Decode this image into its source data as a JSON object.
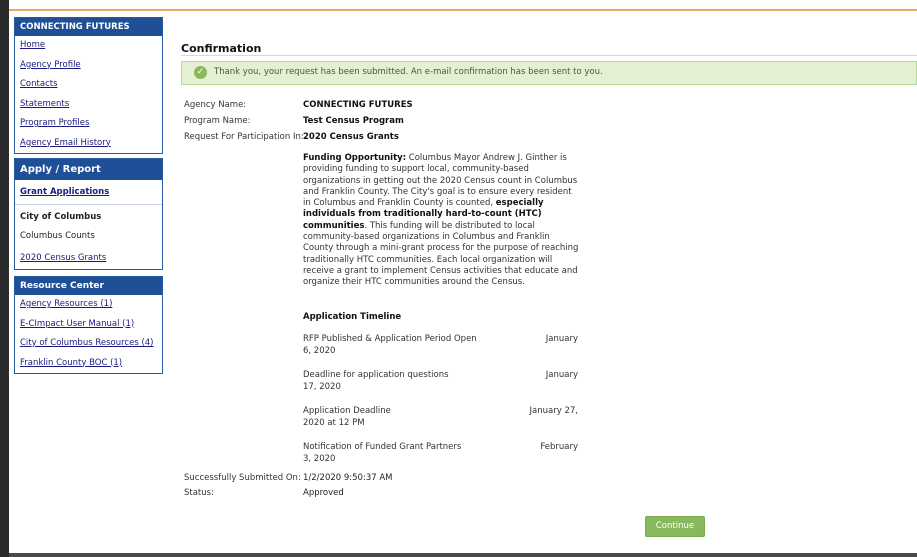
{
  "sidebar": {
    "panel1": {
      "header": "CONNECTING FUTURES",
      "items": [
        "Home",
        "Agency Profile",
        "Contacts",
        "Statements",
        "Program Profiles",
        "Agency Email History"
      ]
    },
    "panel2": {
      "header": "Apply / Report",
      "grant_applications": "Grant Applications",
      "city_label": "City of Columbus",
      "columbus_counts": "Columbus Counts",
      "census_grants": "2020 Census Grants"
    },
    "panel3": {
      "header": "Resource Center",
      "items": [
        "Agency Resources (1)",
        "E-CImpact User Manual (1)",
        "City of Columbus Resources (4)",
        "Franklin County BOC (1)"
      ]
    }
  },
  "main": {
    "title": "Confirmation",
    "alert": "Thank you, your request has been submitted. An e-mail confirmation has been sent to you.",
    "agency_label": "Agency Name:",
    "agency_value": "CONNECTING FUTURES",
    "program_label": "Program Name:",
    "program_value": "Test Census Program",
    "request_label": "Request For Participation In:",
    "request_value": "2020 Census Grants",
    "description": {
      "lead": "Funding Opportunity:",
      "p1": " Columbus Mayor Andrew J. Ginther is providing funding to support local, community-based organizations in getting out the 2020 Census count in Columbus and Franklin County. The City's goal is to ensure every resident in Columbus and Franklin County is counted, ",
      "emph": "especially individuals from traditionally hard-to-count (HTC) communities",
      "p2": ". This funding will be distributed to local community-based organizations in Columbus and Franklin County through a mini-grant process for the purpose of reaching traditionally HTC communities.  Each local organization will receive a grant to implement Census activities that educate and organize their HTC communities around the Census."
    },
    "timeline_title": "Application Timeline",
    "timeline": [
      {
        "event": "RFP Published & Application Period Open",
        "date": "January",
        "cont": "6, 2020"
      },
      {
        "event": "Deadline for application questions",
        "date": "January",
        "cont": "17, 2020"
      },
      {
        "event": "Application Deadline",
        "date": "January 27,",
        "cont": "2020 at 12 PM"
      },
      {
        "event": "Notification of Funded Grant Partners",
        "date": "February",
        "cont": "3, 2020"
      }
    ],
    "submitted_label": "Successfully Submitted On:",
    "submitted_value": "1/2/2020 9:50:37 AM",
    "status_label": "Status:",
    "status_value": "Approved",
    "continue_label": "Continue"
  },
  "colors": {
    "nav_header": "#1f4f96",
    "alert_bg": "#e3f0d4",
    "continue_bg": "#88b85c"
  },
  "icons": {
    "alert": "check-circle-icon"
  }
}
